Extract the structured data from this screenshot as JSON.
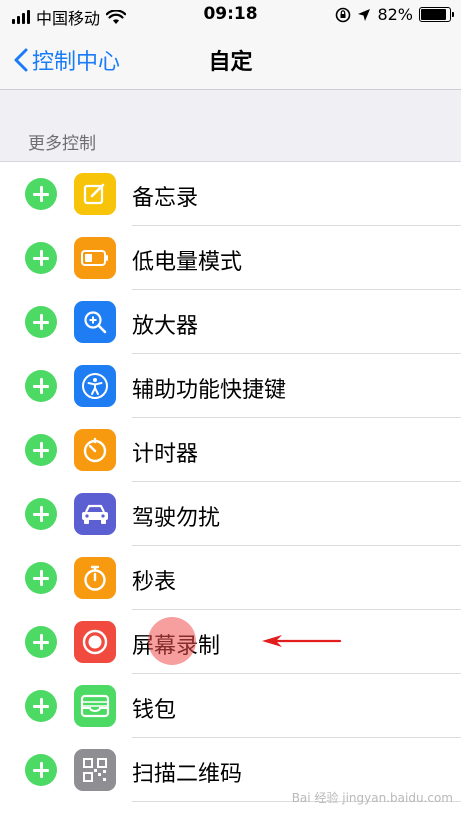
{
  "status_bar": {
    "carrier": "中国移动",
    "time": "09:18",
    "battery_percent": "82%"
  },
  "nav": {
    "back_label": "控制中心",
    "title": "自定"
  },
  "section": {
    "title": "更多控制"
  },
  "items": [
    {
      "label": "备忘录",
      "icon": "notes-icon",
      "color": "#f7c409"
    },
    {
      "label": "低电量模式",
      "icon": "battery-icon",
      "color": "#f89a0f"
    },
    {
      "label": "放大器",
      "icon": "magnifier-icon",
      "color": "#1e7df3"
    },
    {
      "label": "辅助功能快捷键",
      "icon": "accessibility-icon",
      "color": "#1e7df3"
    },
    {
      "label": "计时器",
      "icon": "timer-icon",
      "color": "#f89a0f"
    },
    {
      "label": "驾驶勿扰",
      "icon": "car-icon",
      "color": "#5b5fd1"
    },
    {
      "label": "秒表",
      "icon": "stopwatch-icon",
      "color": "#f89a0f"
    },
    {
      "label": "屏幕录制",
      "icon": "screen-record-icon",
      "color": "#f14a3e"
    },
    {
      "label": "钱包",
      "icon": "wallet-icon",
      "color": "#4cd964"
    },
    {
      "label": "扫描二维码",
      "icon": "qr-code-icon",
      "color": "#8e8e93"
    }
  ],
  "annotations": {
    "highlight_item": "屏幕录制",
    "arrow_color": "#e11d1d",
    "add_button_color": "#4cd964"
  },
  "watermark": "Bai 经验 jingyan.baidu.com"
}
